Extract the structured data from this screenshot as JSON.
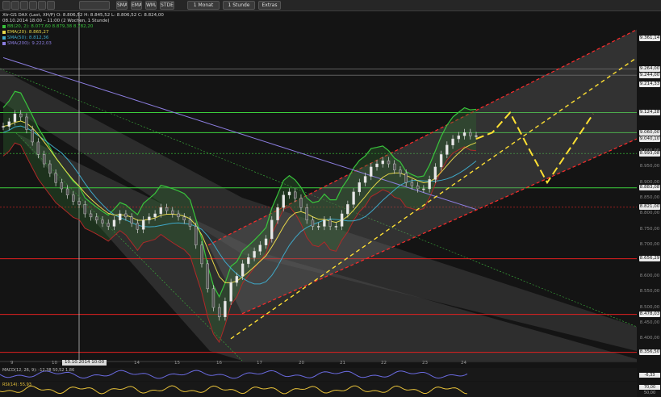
{
  "toolbar": {
    "items": [
      "",
      "",
      "",
      "",
      "",
      "",
      "",
      "SMA",
      "EMA",
      "WMA",
      "STDEV",
      "1 Monat",
      "1 Stunde",
      "Extras"
    ]
  },
  "header": {
    "symbol_line": "Xtr-GS DAX (Last, XH/P) O: 8.806,52  H: 8.845,52  L: 8.806,52  C: 8.824,00",
    "date_line": "08.10.2014 18:00 – 11:00 (2 Wochen, 1 Stunde)"
  },
  "legend": [
    {
      "label": "BB(20, 2): 8.077,60  8.879,38  8.782,20",
      "color": "#39c43c"
    },
    {
      "label": "EMA(20): 8.865,27",
      "color": "#e8d84a"
    },
    {
      "label": "SMA(50): 8.812,36",
      "color": "#3fa8c8"
    },
    {
      "label": "SMA(200): 9.222,03",
      "color": "#8c7ee0"
    }
  ],
  "price_labels": [
    {
      "text": "9.361,14",
      "y": 9361.14,
      "boxed": true
    },
    {
      "text": "9.264,00",
      "y": 9264.0,
      "boxed": true
    },
    {
      "text": "9.244,00",
      "y": 9244.0,
      "boxed": true
    },
    {
      "text": "9.214,33",
      "y": 9214.33,
      "boxed": true
    },
    {
      "text": "9.124,28",
      "y": 9124.28,
      "boxed": true
    },
    {
      "text": "9.050,00",
      "y": 9050.0,
      "boxed": false
    },
    {
      "text": "9.060,00",
      "y": 9060.0,
      "boxed": true
    },
    {
      "text": "9.040,10",
      "y": 9040.1,
      "boxed": true
    },
    {
      "text": "9.000,00",
      "y": 9000.0,
      "boxed": false
    },
    {
      "text": "8.993,08",
      "y": 8993.08,
      "boxed": true
    },
    {
      "text": "8.950,00",
      "y": 8950.0,
      "boxed": false
    },
    {
      "text": "8.900,00",
      "y": 8900.0,
      "boxed": false
    },
    {
      "text": "8.883,08",
      "y": 8883.08,
      "boxed": true
    },
    {
      "text": "8.850,00",
      "y": 8850.0,
      "boxed": false
    },
    {
      "text": "8.821,00",
      "y": 8821.0,
      "boxed": true
    },
    {
      "text": "8.800,00",
      "y": 8800.0,
      "boxed": false
    },
    {
      "text": "8.750,00",
      "y": 8750.0,
      "boxed": false
    },
    {
      "text": "8.700,00",
      "y": 8700.0,
      "boxed": false
    },
    {
      "text": "8.656,29",
      "y": 8656.29,
      "boxed": true
    },
    {
      "text": "8.600,00",
      "y": 8600.0,
      "boxed": false
    },
    {
      "text": "8.550,00",
      "y": 8550.0,
      "boxed": false
    },
    {
      "text": "8.500,00",
      "y": 8500.0,
      "boxed": false
    },
    {
      "text": "8.478,03",
      "y": 8478.03,
      "boxed": true
    },
    {
      "text": "8.450,00",
      "y": 8450.0,
      "boxed": false
    },
    {
      "text": "8.400,00",
      "y": 8400.0,
      "boxed": false
    },
    {
      "text": "8.356,50",
      "y": 8356.5,
      "boxed": true
    }
  ],
  "x_ticks": [
    "9",
    "10",
    "13",
    "14",
    "15",
    "16",
    "17",
    "20",
    "21",
    "22",
    "23",
    "24"
  ],
  "cursor_date": "10.10.2014 10:00",
  "indicators": {
    "macd_label": "MACD(12, 26, 9): -12,38  50,52  1,86",
    "macd_value": "-6,33",
    "rsi_label": "RSI(14): 55,93",
    "rsi_value": "70,00",
    "rsi_value2": "50,00"
  },
  "colors": {
    "background": "#141414",
    "bollinger": "#39c43c",
    "ema": "#e8d84a",
    "sma50": "#3fa8c8",
    "sma200": "#8c7ee0",
    "support_red": "#e02020",
    "green_level": "#3ccf3c",
    "projection": "#ffe033",
    "channel_red": "#ff2a2a"
  },
  "chart_data": {
    "type": "line",
    "title": "Xtr-GS DAX",
    "ylim": [
      8340,
      9420
    ],
    "series": [
      {
        "name": "Close",
        "values": [
          9080,
          9095,
          9120,
          9110,
          9070,
          9030,
          8990,
          8960,
          8930,
          8900,
          8880,
          8860,
          8840,
          8830,
          8800,
          8790,
          8780,
          8770,
          8760,
          8780,
          8800,
          8790,
          8770,
          8750,
          8780,
          8790,
          8800,
          8820,
          8810,
          8800,
          8790,
          8780,
          8760,
          8700,
          8640,
          8560,
          8500,
          8470,
          8520,
          8580,
          8600,
          8640,
          8660,
          8680,
          8700,
          8720,
          8780,
          8820,
          8860,
          8870,
          8850,
          8820,
          8780,
          8760,
          8760,
          8780,
          8760,
          8760,
          8800,
          8830,
          8870,
          8900,
          8920,
          8950,
          8960,
          8970,
          8960,
          8940,
          8930,
          8900,
          8890,
          8880,
          8880,
          8910,
          8950,
          8990,
          9020,
          9040,
          9050,
          9060,
          9050,
          9050
        ]
      }
    ],
    "horizontal_levels": {
      "green": [
        9124.28,
        9060.0,
        8883.08
      ],
      "red": [
        8656.29,
        8478.03,
        8356.5
      ]
    },
    "projection_path": [
      [
        9060,
        9124
      ],
      [
        9124,
        9010
      ],
      [
        8900,
        9120
      ]
    ]
  }
}
